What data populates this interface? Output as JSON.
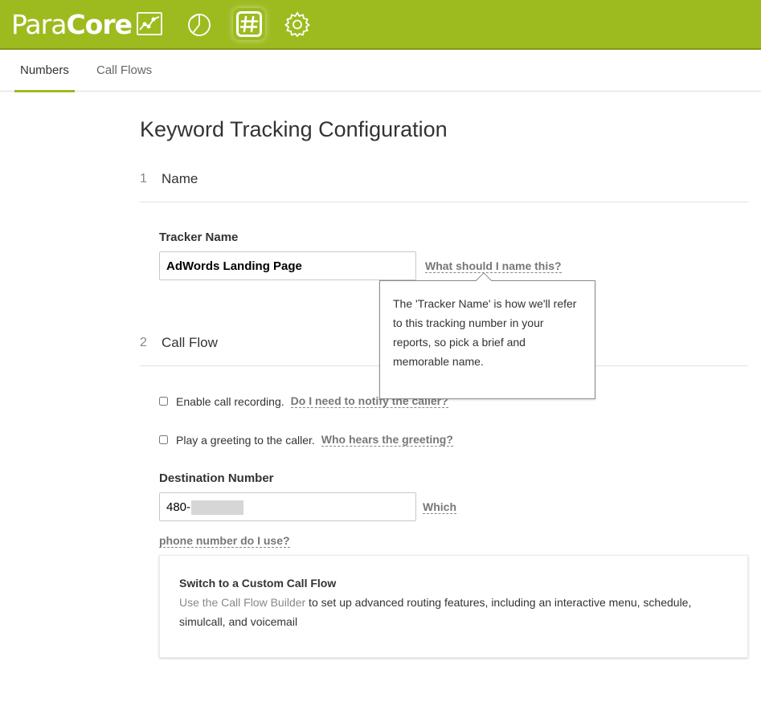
{
  "app": {
    "logo_part1": "Para",
    "logo_part2": "Core",
    "nav_icons": [
      "chart-line-icon",
      "pie-chart-icon",
      "hashtag-icon",
      "gear-icon"
    ],
    "active_nav": "hashtag-icon",
    "accent_color": "#9dbb1f"
  },
  "tabs": [
    {
      "label": "Numbers",
      "active": true
    },
    {
      "label": "Call Flows",
      "active": false
    }
  ],
  "page": {
    "title": "Keyword Tracking Configuration"
  },
  "sections": {
    "name": {
      "number": "1",
      "title": "Name"
    },
    "call_flow": {
      "number": "2",
      "title": "Call Flow"
    }
  },
  "tracker": {
    "label": "Tracker Name",
    "value": "AdWords Landing Page",
    "help_link": "What should I name this?",
    "tooltip": "The 'Tracker Name' is how we'll refer to this tracking number in your reports, so pick a brief and memorable name."
  },
  "options": {
    "recording_label": "Enable call recording.",
    "recording_help": "Do I need to notify the caller?",
    "recording_checked": false,
    "greeting_label": "Play a greeting to the caller.",
    "greeting_help": "Who hears the greeting?",
    "greeting_checked": false
  },
  "destination": {
    "label": "Destination Number",
    "value_prefix": "480-",
    "help_link_part1": "Which",
    "help_link_part2": "phone number do I use?"
  },
  "custom_flow": {
    "title": "Switch to a Custom Call Flow",
    "link_text": "Use the Call Flow Builder",
    "body_text": " to set up advanced routing features, including an interactive menu, schedule, simulcall, and voicemail"
  }
}
